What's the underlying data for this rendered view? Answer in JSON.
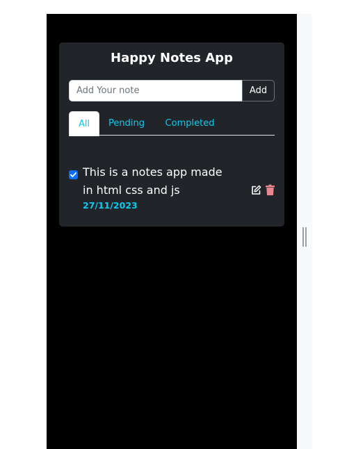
{
  "app": {
    "title": "Happy Notes App",
    "accent_color": "#0dcaf0",
    "card_color": "#212529"
  },
  "input": {
    "placeholder": "Add Your note",
    "value": "",
    "add_label": "Add"
  },
  "tabs": [
    {
      "label": "All",
      "active": true
    },
    {
      "label": "Pending",
      "active": false
    },
    {
      "label": "Completed",
      "active": false
    }
  ],
  "notes": [
    {
      "text": "This is a notes app made in html css and js",
      "date": "27/11/2023",
      "checked": true,
      "actions": [
        "edit-icon",
        "trash-icon"
      ]
    }
  ]
}
